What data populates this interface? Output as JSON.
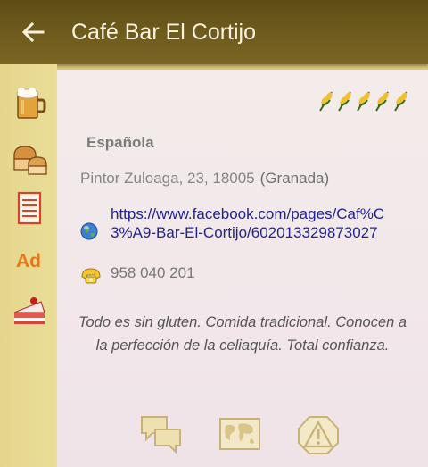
{
  "appbar": {
    "title": "Café Bar El Cortijo",
    "back_icon": "arrow-left-icon"
  },
  "sidebar": {
    "items": [
      {
        "name": "beer-mug-icon"
      },
      {
        "name": "bread-icon"
      },
      {
        "name": "menu-list-icon"
      },
      {
        "name": "ad-icon",
        "label": "Ad"
      },
      {
        "name": "cake-icon"
      }
    ]
  },
  "listing": {
    "rating_icon": "wheat-ear-icon",
    "rating": 5,
    "rating_max": 5,
    "cuisine": "Española",
    "address": "Pintor Zuloaga, 23, 18005",
    "city": "(Granada)",
    "website": "https://www.facebook.com/pages/Caf%C3%A9-Bar-El-Cortijo/602013329873027",
    "phone": "958 040 201",
    "description": "Todo es sin gluten. Comida tradicional. Conocen a la perfección de la celiaquía. Total confianza."
  },
  "actions": [
    {
      "name": "comments-button",
      "icon": "chat-bubbles-icon"
    },
    {
      "name": "map-button",
      "icon": "world-map-icon"
    },
    {
      "name": "report-button",
      "icon": "warning-icon"
    }
  ],
  "colors": {
    "appbar": "#6a5719",
    "sidebar": "#e8da93",
    "card": "#f3eaea",
    "link": "#23238f",
    "ad_text": "#e8771a"
  }
}
